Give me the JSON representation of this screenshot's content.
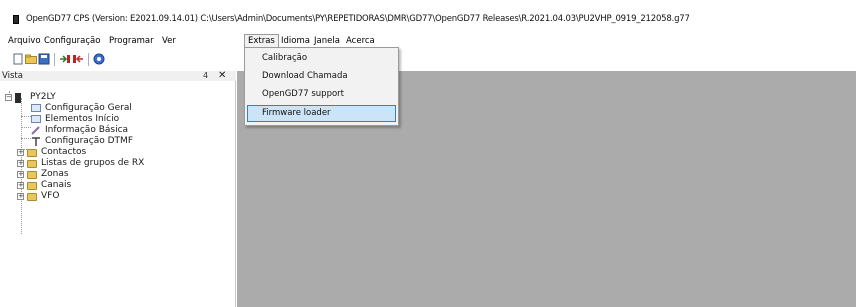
{
  "window": {
    "title": "OpenGD77 CPS (Version: E2021.09.14.01) C:\\Users\\Admin\\Documents\\PY\\REPETIDORAS\\DMR\\GD77\\OpenGD77 Releases\\R.2021.04.03\\PU2VHP_0919_212058.g77"
  },
  "menubar": {
    "items": [
      "Arquivo",
      "Configuração",
      "Programar",
      "Ver",
      "Extras",
      "Idioma",
      "Janela",
      "Acerca"
    ]
  },
  "extras_menu": {
    "items": [
      "Calibração",
      "Download Chamada",
      "OpenGD77 support",
      "Firmware loader"
    ],
    "highlighted": "Firmware loader"
  },
  "panel": {
    "title": "Vista",
    "pin": "4",
    "close": "✕"
  },
  "tree": {
    "root": "PY2LY",
    "children": [
      "Configuração Geral",
      "Elementos Início",
      "Informação Básica",
      "Configuração DTMF",
      "Contactos",
      "Listas de grupos de RX",
      "Zonas",
      "Canais",
      "VFO"
    ],
    "expand_symbol": "+",
    "collapse_symbol": "−"
  },
  "colors": {
    "workspace": "#ababab",
    "menu_highlight": "#cce4f7",
    "menu_highlight_border": "#3c7fb1",
    "folder": "#e8c65a"
  }
}
